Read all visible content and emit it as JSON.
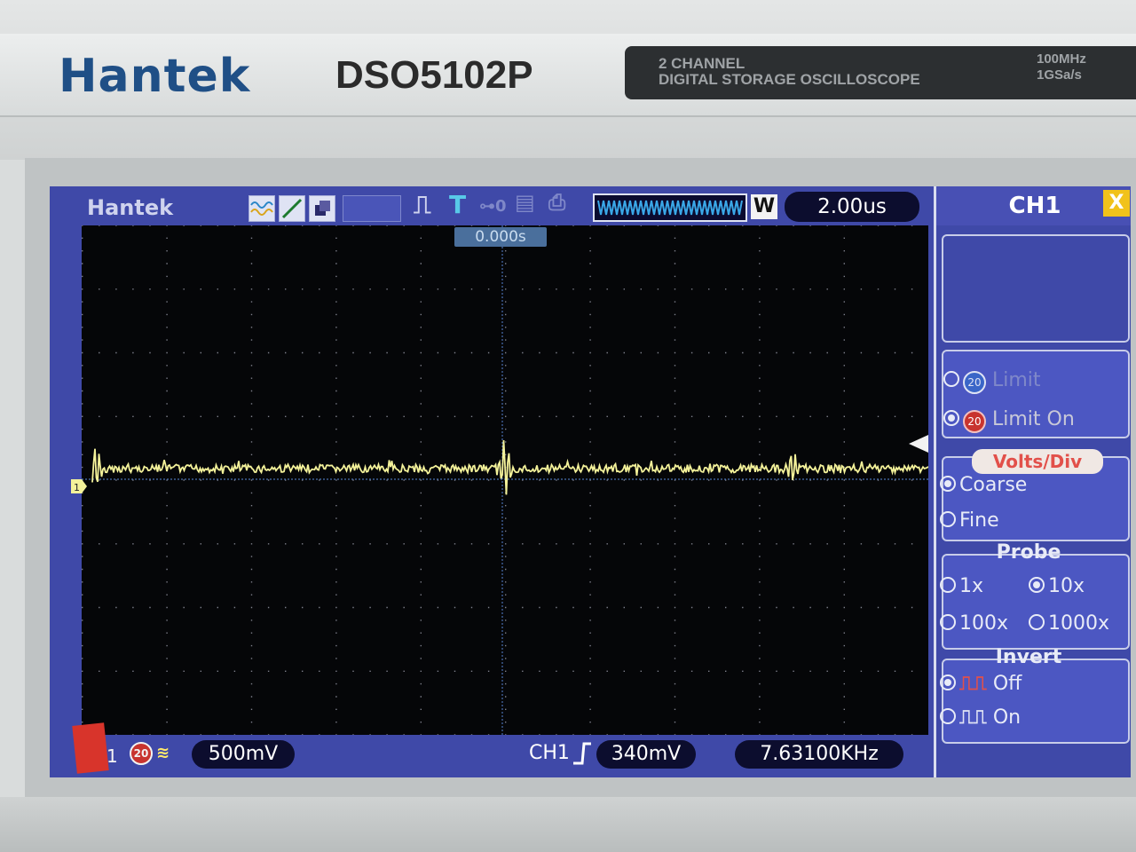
{
  "device": {
    "brand": "Hantek",
    "model": "DSO5102P",
    "description_line1": "2 CHANNEL",
    "description_line2": "DIGITAL STORAGE OSCILLOSCOPE",
    "spec_bandwidth": "100MHz",
    "spec_sample_rate": "1GSa/s"
  },
  "topbar": {
    "logo": "Hantek",
    "icons": [
      "waveform-icon",
      "line-icon",
      "copy-icon",
      "run-stop-icon",
      "trigger-t-icon",
      "probe-icon",
      "save-icon",
      "print-icon"
    ],
    "memory_mode": "W",
    "timebase": "2.00us"
  },
  "screen": {
    "trigger_position": "0.000s"
  },
  "status": {
    "channel_label": "1",
    "bandwidth_limit_badge": "20",
    "volts_per_div": "500mV",
    "trigger_source": "CH1",
    "trigger_level": "340mV",
    "frequency": "7.63100KHz"
  },
  "menu": {
    "title": "CH1",
    "close": "X",
    "bw_options": [
      {
        "badge": "20",
        "label": "Limit",
        "selected": false
      },
      {
        "badge": "20",
        "label": "Limit On",
        "selected": true
      }
    ],
    "volts_div_title": "Volts/Div",
    "volts_div_options": [
      {
        "label": "Coarse",
        "selected": true
      },
      {
        "label": "Fine",
        "selected": false
      }
    ],
    "probe_title": "Probe",
    "probe_options": [
      {
        "label": "1x",
        "selected": false
      },
      {
        "label": "10x",
        "selected": true
      },
      {
        "label": "100x",
        "selected": false
      },
      {
        "label": "1000x",
        "selected": false
      }
    ],
    "invert_title": "Invert",
    "invert_options": [
      {
        "label": "Off",
        "selected": true
      },
      {
        "label": "On",
        "selected": false
      }
    ]
  },
  "colors": {
    "trace": "#f4f29a",
    "lcd_background": "#3f49a8",
    "graticule": "#050608",
    "accent": "#e2504a"
  }
}
